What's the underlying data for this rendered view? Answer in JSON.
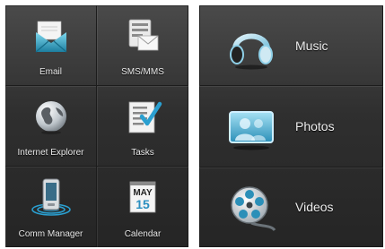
{
  "left_menu": {
    "items": [
      {
        "label": "Email",
        "icon": "email-icon"
      },
      {
        "label": "SMS/MMS",
        "icon": "sms-mms-icon"
      },
      {
        "label": "Internet Explorer",
        "icon": "internet-explorer-globe-icon"
      },
      {
        "label": "Tasks",
        "icon": "tasks-checklist-icon"
      },
      {
        "label": "Comm Manager",
        "icon": "comm-manager-phone-icon"
      },
      {
        "label": "Calendar",
        "icon": "calendar-icon"
      }
    ],
    "calendar_month": "MAY",
    "calendar_day": "15"
  },
  "media_menu": {
    "items": [
      {
        "label": "Music",
        "icon": "headphones-icon"
      },
      {
        "label": "Photos",
        "icon": "photos-icon"
      },
      {
        "label": "Videos",
        "icon": "film-reel-icon"
      }
    ]
  }
}
